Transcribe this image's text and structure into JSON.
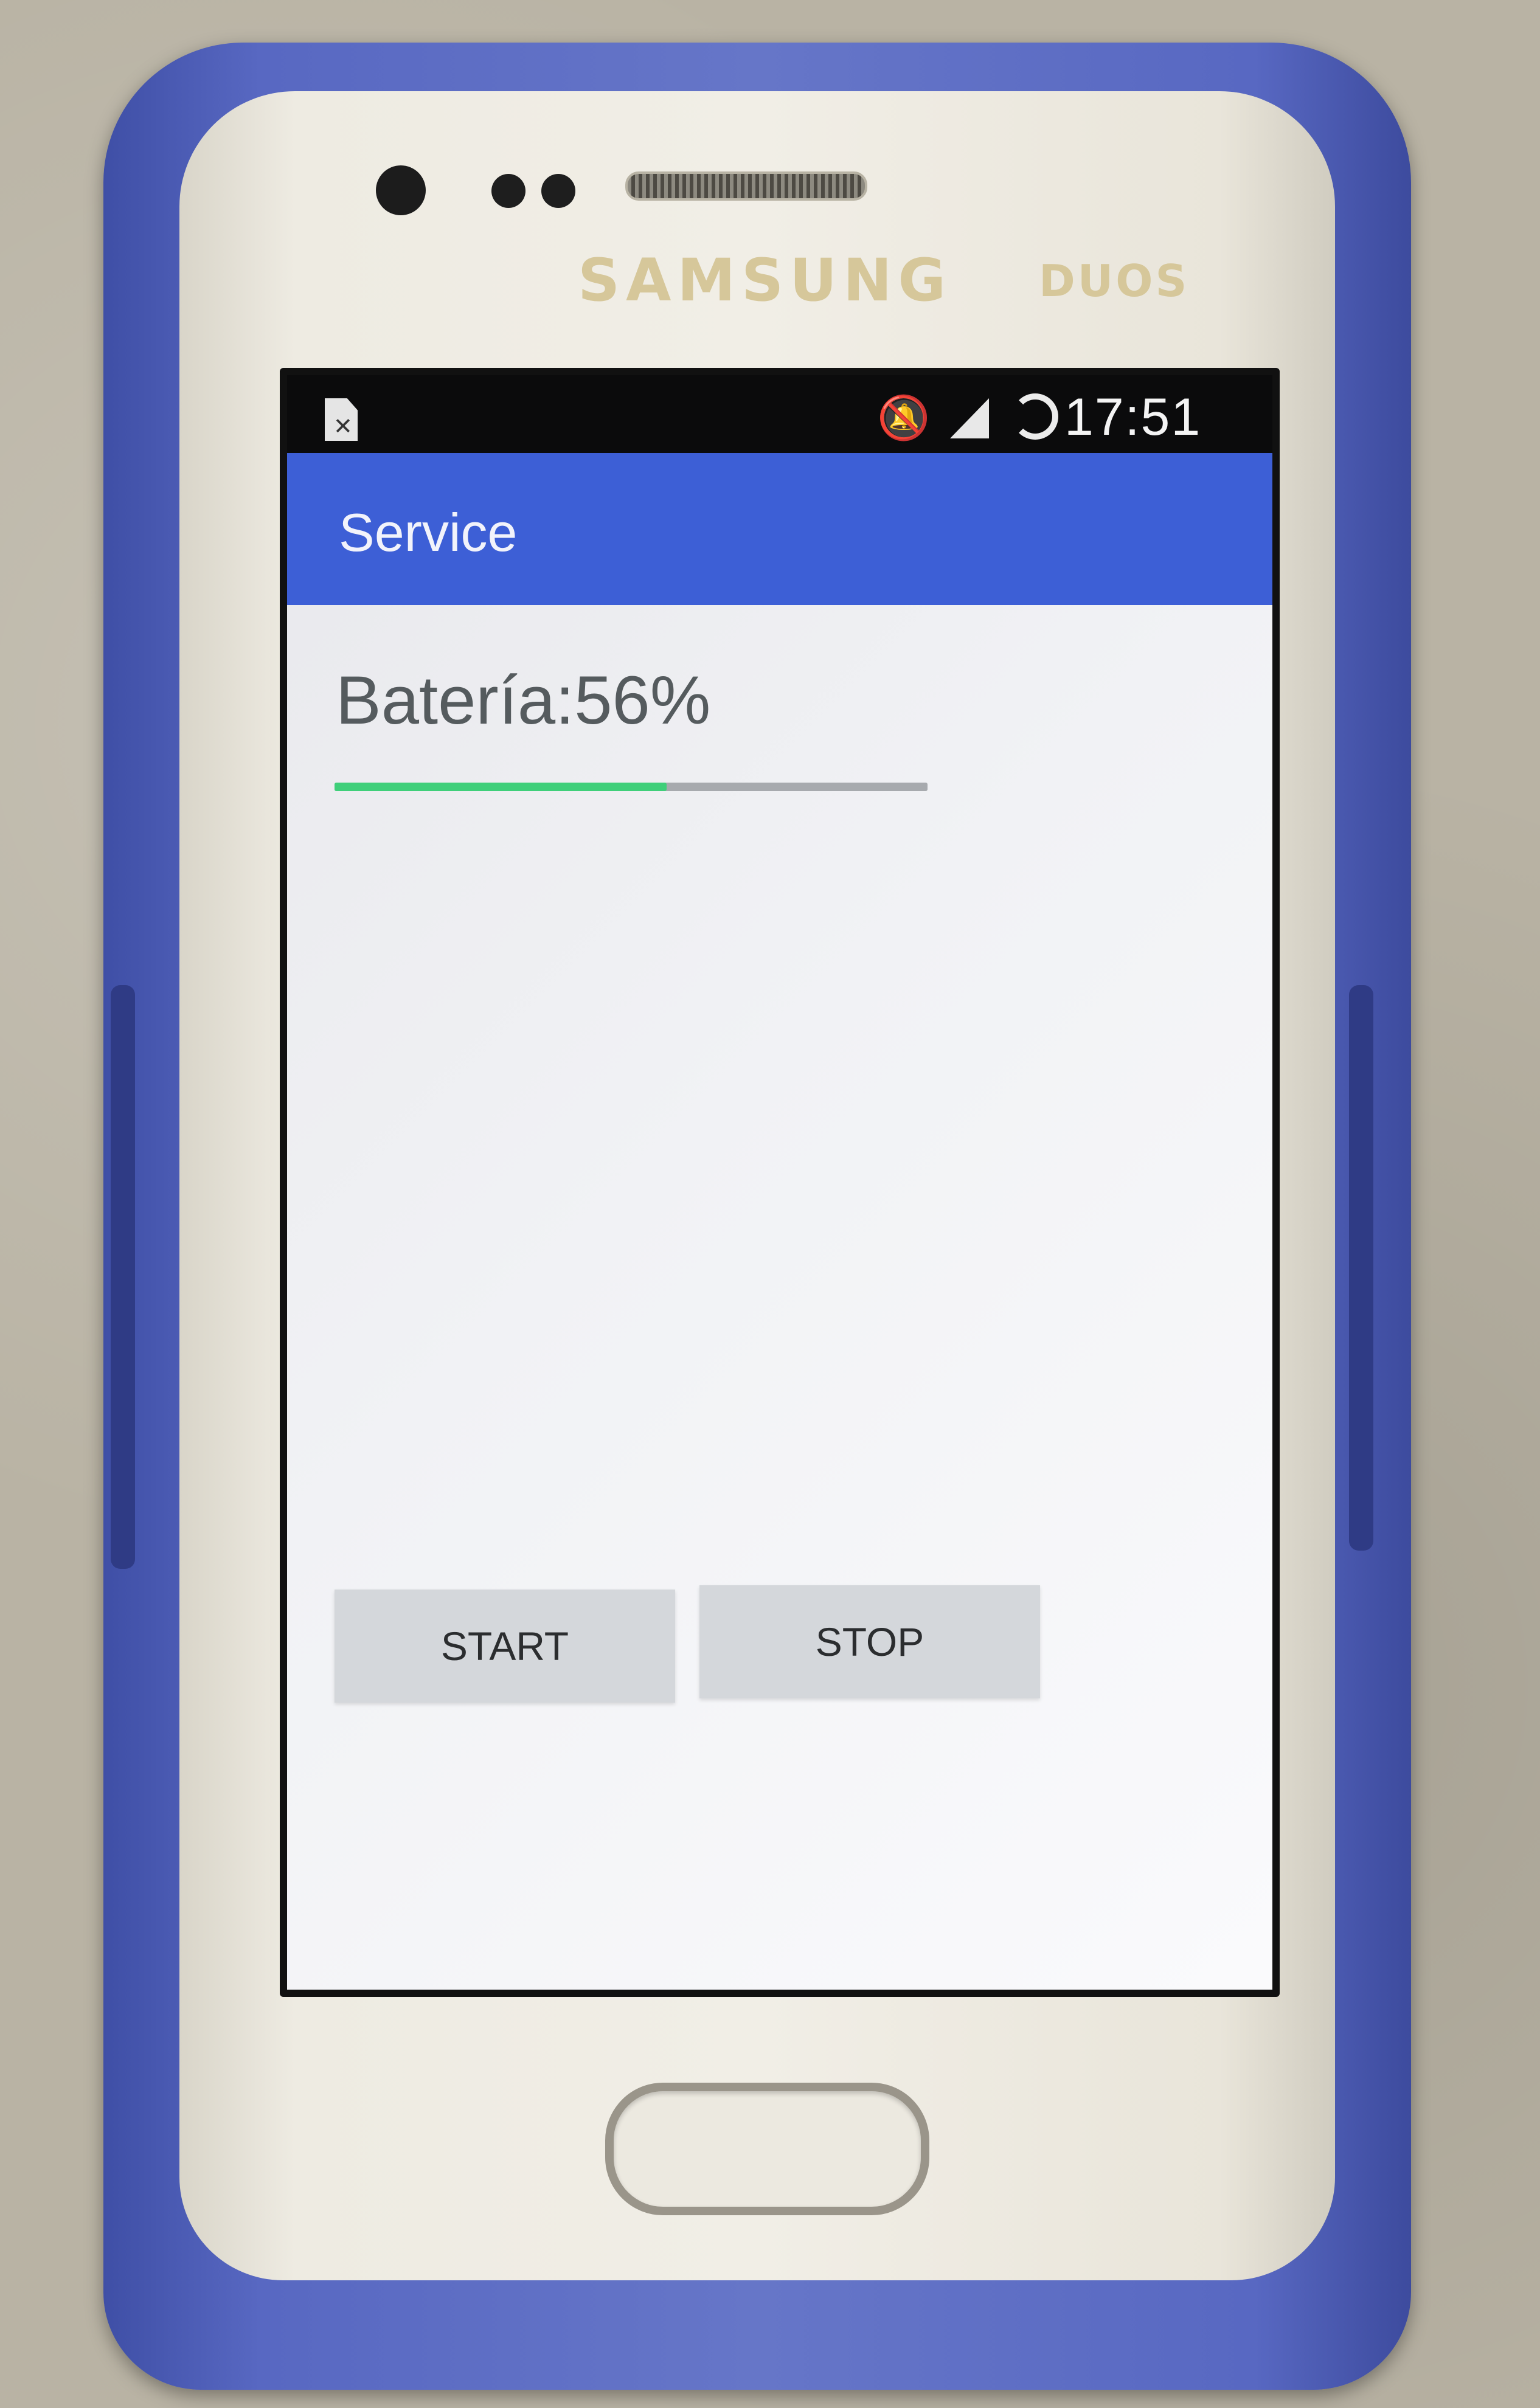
{
  "device": {
    "brand": "SAMSUNG",
    "model_badge": "DUOS"
  },
  "status_bar": {
    "time": "17:51",
    "icons": [
      "sim-card-icon",
      "bell-off-icon",
      "signal-icon",
      "sync-icon"
    ]
  },
  "app_bar": {
    "title": "Service",
    "color": "#3d5fd6"
  },
  "battery": {
    "label": "Batería:56%",
    "progress_percent": 56,
    "progress_color": "#3fcf7a"
  },
  "buttons": {
    "start_label": "START",
    "stop_label": "STOP"
  }
}
